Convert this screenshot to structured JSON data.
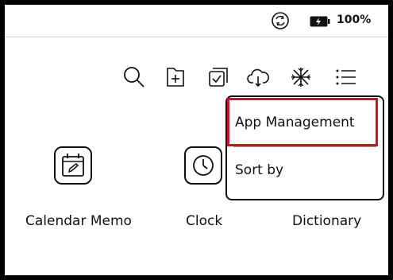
{
  "status_bar": {
    "battery_percent": "100%",
    "icons": [
      "sync-icon",
      "battery-charging-icon"
    ]
  },
  "toolbar": {
    "icons": [
      "search-icon",
      "add-folder-icon",
      "multi-select-icon",
      "cloud-sync-icon",
      "snowflake-icon",
      "list-menu-icon"
    ]
  },
  "apps": [
    {
      "label": "Calendar Memo",
      "icon": "calendar-edit-icon"
    },
    {
      "label": "Clock",
      "icon": "clock-icon"
    },
    {
      "label": "Dictionary",
      "icon": "dictionary-icon"
    }
  ],
  "menu": {
    "items": [
      {
        "label": "App Management"
      },
      {
        "label": "Sort by"
      }
    ]
  },
  "colors": {
    "highlight": "#d0121b",
    "frame": "#000000",
    "background": "#ffffff"
  }
}
